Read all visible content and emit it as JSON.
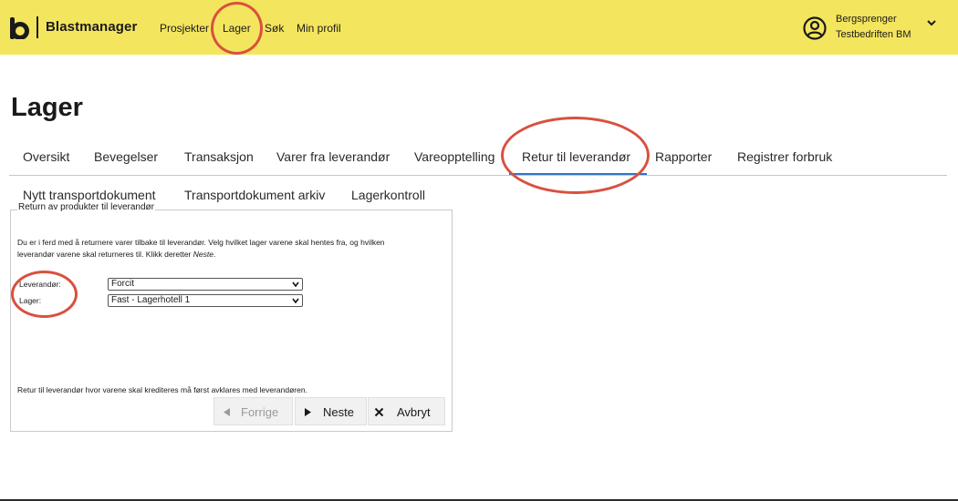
{
  "header": {
    "brand": "Blastmanager",
    "nav": [
      {
        "label": "Prosjekter"
      },
      {
        "label": "Lager"
      },
      {
        "label": "Søk"
      },
      {
        "label": "Min profil"
      }
    ],
    "user": {
      "name": "Bergsprenger",
      "company": "Testbedriften BM"
    },
    "icons": [
      "blastmanager-logo-icon",
      "user-avatar-icon",
      "chevron-down-icon"
    ]
  },
  "page": {
    "title": "Lager"
  },
  "tabs": [
    {
      "label": "Oversikt"
    },
    {
      "label": "Bevegelser"
    },
    {
      "label": "Transaksjon"
    },
    {
      "label": "Varer fra leverandør"
    },
    {
      "label": "Vareopptelling"
    },
    {
      "label": "Retur til leverandør",
      "active": true
    },
    {
      "label": "Rapporter"
    },
    {
      "label": "Registrer forbruk"
    }
  ],
  "subtabs": [
    {
      "label": "Nytt transportdokument"
    },
    {
      "label": "Transportdokument arkiv"
    },
    {
      "label": "Lagerkontroll"
    }
  ],
  "panel": {
    "legend": "Return av produkter til leverandør",
    "intro_line1": "Du er i ferd med å returnere varer tilbake til leverandør. Velg hvilket lager varene skal hentes fra, og hvilken",
    "intro_line2_prefix": "leverandør varene skal returneres til. Klikk deretter ",
    "intro_line2_em": "Neste",
    "intro_line2_suffix": ".",
    "supplier": {
      "label": "Leverandør:",
      "value": "Forcit"
    },
    "warehouse": {
      "label": "Lager:",
      "value": "Fast - Lagerhotell 1"
    },
    "note": "Retur til leverandør hvor varene skal krediteres må først avklares med leverandøren.",
    "buttons": {
      "previous": "Forrige",
      "next": "Neste",
      "cancel": "Avbryt"
    }
  },
  "colors": {
    "header_bg": "#f4e55e",
    "active_tab": "#2e74c9",
    "annotation": "#d9503f"
  }
}
